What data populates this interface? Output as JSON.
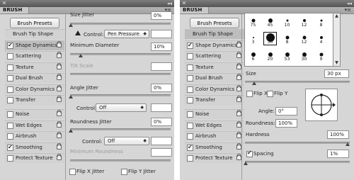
{
  "left_panel": {
    "title": "BRUSH",
    "close_glyph": "✕",
    "collapse_glyph": "◂◂",
    "tab_label": "BRUSH",
    "menu_glyph": "▾≡",
    "presets_button": "Brush Presets",
    "sidebar": [
      {
        "label": "Brush Tip Shape",
        "header": true
      },
      {
        "label": "Shape Dynamics",
        "checked": true,
        "lock": true,
        "active": true
      },
      {
        "label": "Scattering",
        "checked": false,
        "lock": true
      },
      {
        "label": "Texture",
        "checked": false,
        "lock": true
      },
      {
        "label": "Dual Brush",
        "checked": false,
        "lock": true
      },
      {
        "label": "Color Dynamics",
        "checked": false,
        "lock": true
      },
      {
        "label": "Transfer",
        "checked": false,
        "lock": true
      },
      {
        "label": "Noise",
        "checked": false,
        "lock": true
      },
      {
        "label": "Wet Edges",
        "checked": false,
        "lock": true
      },
      {
        "label": "Airbrush",
        "checked": false,
        "lock": true
      },
      {
        "label": "Smoothing",
        "checked": true,
        "lock": true
      },
      {
        "label": "Protect Texture",
        "checked": false,
        "lock": true
      }
    ],
    "size_jitter": {
      "label": "Size Jitter",
      "value": "0%"
    },
    "control1": {
      "label": "Control:",
      "value": "Pen Pressure",
      "extra": ""
    },
    "min_diameter": {
      "label": "Minimum Diameter",
      "value": "10%"
    },
    "tilt_scale": {
      "label": "Tilt Scale",
      "value": ""
    },
    "angle_jitter": {
      "label": "Angle Jitter",
      "value": "0%"
    },
    "control2": {
      "label": "Control:",
      "value": "Off",
      "extra": ""
    },
    "roundness_jitter": {
      "label": "Roundness Jitter",
      "value": "0%"
    },
    "control3": {
      "label": "Control:",
      "value": "Off",
      "extra": ""
    },
    "min_roundness": {
      "label": "Minimum Roundness",
      "value": ""
    },
    "flip_x": {
      "label": "Flip X Jitter"
    },
    "flip_y": {
      "label": "Flip Y Jitter"
    }
  },
  "right_panel": {
    "title": "BRUSH",
    "close_glyph": "✕",
    "collapse_glyph": "◂◂",
    "tab_label": "BRUSH",
    "menu_glyph": "▾≡",
    "presets_button": "Brush Presets",
    "sidebar": [
      {
        "label": "Brush Tip Shape",
        "header": true,
        "active": true
      },
      {
        "label": "Shape Dynamics",
        "checked": true,
        "lock": true
      },
      {
        "label": "Scattering",
        "checked": false,
        "lock": true
      },
      {
        "label": "Texture",
        "checked": false,
        "lock": true
      },
      {
        "label": "Dual Brush",
        "checked": false,
        "lock": true
      },
      {
        "label": "Color Dynamics",
        "checked": false,
        "lock": true
      },
      {
        "label": "Transfer",
        "checked": false,
        "lock": true
      },
      {
        "label": "Noise",
        "checked": false,
        "lock": true
      },
      {
        "label": "Wet Edges",
        "checked": false,
        "lock": true
      },
      {
        "label": "Airbrush",
        "checked": false,
        "lock": true
      },
      {
        "label": "Smoothing",
        "checked": true,
        "lock": true
      },
      {
        "label": "Protect Texture",
        "checked": false,
        "lock": true
      }
    ],
    "tips": [
      {
        "num": "75",
        "size": 5
      },
      {
        "num": "45",
        "size": 6
      },
      {
        "num": "10",
        "size": 3
      },
      {
        "num": "12",
        "size": 4
      },
      {
        "num": "8",
        "size": 3
      },
      {
        "num": "3",
        "size": 2
      },
      {
        "num": "30",
        "size": 12,
        "selected": true
      },
      {
        "num": "8",
        "size": 5
      },
      {
        "num": "12",
        "size": 5
      },
      {
        "num": "4",
        "size": 4
      },
      {
        "num": "6",
        "size": 6
      },
      {
        "num": "20",
        "size": 6
      },
      {
        "num": "53",
        "size": 6
      },
      {
        "num": "30",
        "size": 6
      },
      {
        "num": "9",
        "size": 5
      }
    ],
    "size": {
      "label": "Size",
      "value": "30 px"
    },
    "flip_x": {
      "label": "Flip X"
    },
    "flip_y": {
      "label": "Flip Y"
    },
    "angle": {
      "label": "Angle:",
      "value": "0°"
    },
    "roundness": {
      "label": "Roundness:",
      "value": "100%"
    },
    "hardness": {
      "label": "Hardness",
      "value": "100%"
    },
    "spacing": {
      "label": "Spacing",
      "value": "1%",
      "checked": true
    }
  }
}
